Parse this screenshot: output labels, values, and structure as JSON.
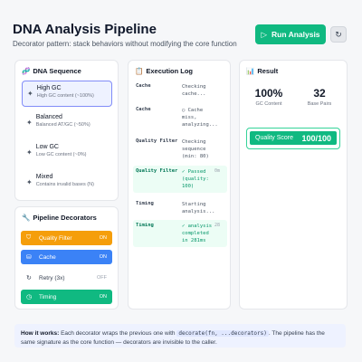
{
  "header": {
    "title": "DNA Analysis Pipeline",
    "subtitle": "Decorator pattern: stack behaviors without modifying the core function",
    "run_label": "Run Analysis"
  },
  "sequence": {
    "title": "DNA Sequence",
    "items": [
      {
        "name": "High GC",
        "desc": "High GC content (~100%)",
        "active": true
      },
      {
        "name": "Balanced",
        "desc": "Balanced AT/GC (~50%)"
      },
      {
        "name": "Low GC",
        "desc": "Low GC content (~0%)"
      },
      {
        "name": "Mixed",
        "desc": "Contains invalid bases (N)"
      }
    ]
  },
  "decorators": {
    "title": "Pipeline Decorators",
    "items": [
      {
        "name": "Quality Filter",
        "state": "ON",
        "color": "#f59e0b"
      },
      {
        "name": "Cache",
        "state": "ON",
        "color": "#3b82f6"
      },
      {
        "name": "Retry (3x)",
        "state": "OFF",
        "color": "#f3f4f6"
      },
      {
        "name": "Timing",
        "state": "ON",
        "color": "#10b981"
      }
    ]
  },
  "log": {
    "title": "Execution Log",
    "rows": [
      {
        "src": "Cache",
        "msg": "Checking cache...",
        "time": ""
      },
      {
        "src": "Cache",
        "msg": "○ Cache miss, analyzing...",
        "time": ""
      },
      {
        "src": "Quality Filter",
        "msg": "Checking sequence (min: 80)",
        "time": ""
      },
      {
        "src": "Quality Filter",
        "msg": "✓ Passed (quality: 100)",
        "time": "0m",
        "ok": true
      },
      {
        "src": "Timing",
        "msg": "Starting analysis...",
        "time": ""
      },
      {
        "src": "Timing",
        "msg": "✓ analysis completed in 281ms",
        "time": "28",
        "ok": true
      }
    ]
  },
  "result": {
    "title": "Result",
    "gc_value": "100%",
    "gc_label": "GC Content",
    "bp_value": "32",
    "bp_label": "Base Pairs",
    "score_label": "Quality Score",
    "score_value": "100/100"
  },
  "footer": {
    "lead": "How it works:",
    "text1": " Each decorator wraps the previous one with ",
    "code": "decorate(fn, ...decorators)",
    "text2": ". The pipeline has the same signature as the core function — decorators are invisible to the caller."
  }
}
